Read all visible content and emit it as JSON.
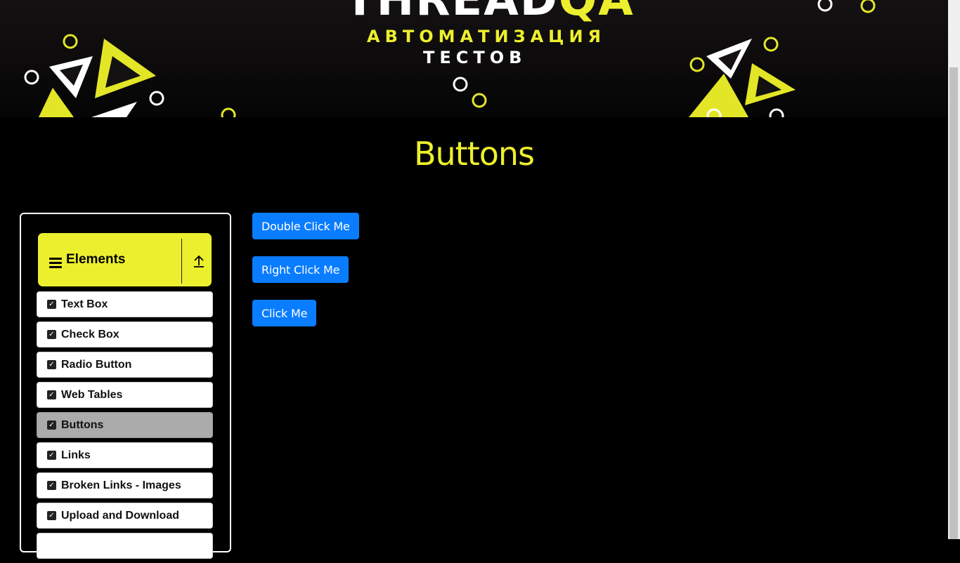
{
  "banner": {
    "brand_white": "THREAD",
    "brand_yellow": "QA",
    "subtitle_line1": "АВТОМАТИЗАЦИЯ",
    "subtitle_line2": "ТЕСТОВ",
    "colors": {
      "yellow": "#ecef2e",
      "white": "#ffffff"
    }
  },
  "page": {
    "title": "Buttons"
  },
  "sidebar": {
    "group_title": "Elements",
    "items": [
      {
        "label": "Text Box",
        "active": false
      },
      {
        "label": "Check Box",
        "active": false
      },
      {
        "label": "Radio Button",
        "active": false
      },
      {
        "label": "Web Tables",
        "active": false
      },
      {
        "label": "Buttons",
        "active": true
      },
      {
        "label": "Links",
        "active": false
      },
      {
        "label": "Broken Links - Images",
        "active": false
      },
      {
        "label": "Upload and Download",
        "active": false
      }
    ]
  },
  "buttons": {
    "double_click": "Double Click Me",
    "right_click": "Right Click Me",
    "click": "Click Me",
    "color": "#0a7cff"
  }
}
